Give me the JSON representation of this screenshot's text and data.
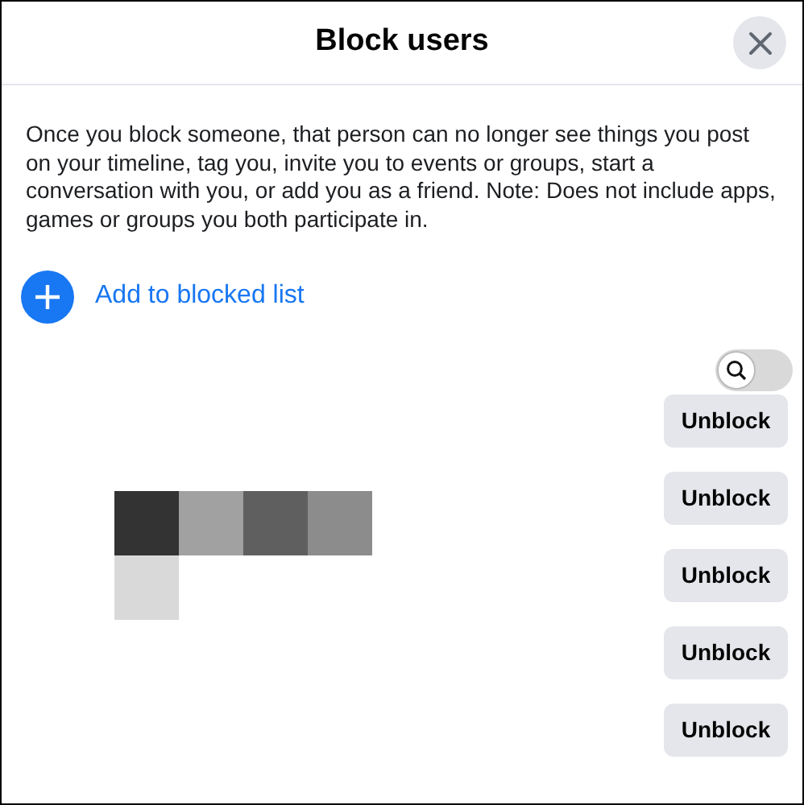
{
  "dialog": {
    "title": "Block users",
    "description": "Once you block someone, that person can no longer see things you post on your timeline, tag you, invite you to events or groups, start a conversation with you, or add you as a friend. Note: Does not include apps, games or groups you both participate in."
  },
  "add_action": {
    "label": "Add to blocked list"
  },
  "search_toggle": {
    "on": false
  },
  "blocked_users": [
    {
      "button": "Unblock"
    },
    {
      "button": "Unblock"
    },
    {
      "button": "Unblock"
    },
    {
      "button": "Unblock"
    },
    {
      "button": "Unblock"
    }
  ]
}
